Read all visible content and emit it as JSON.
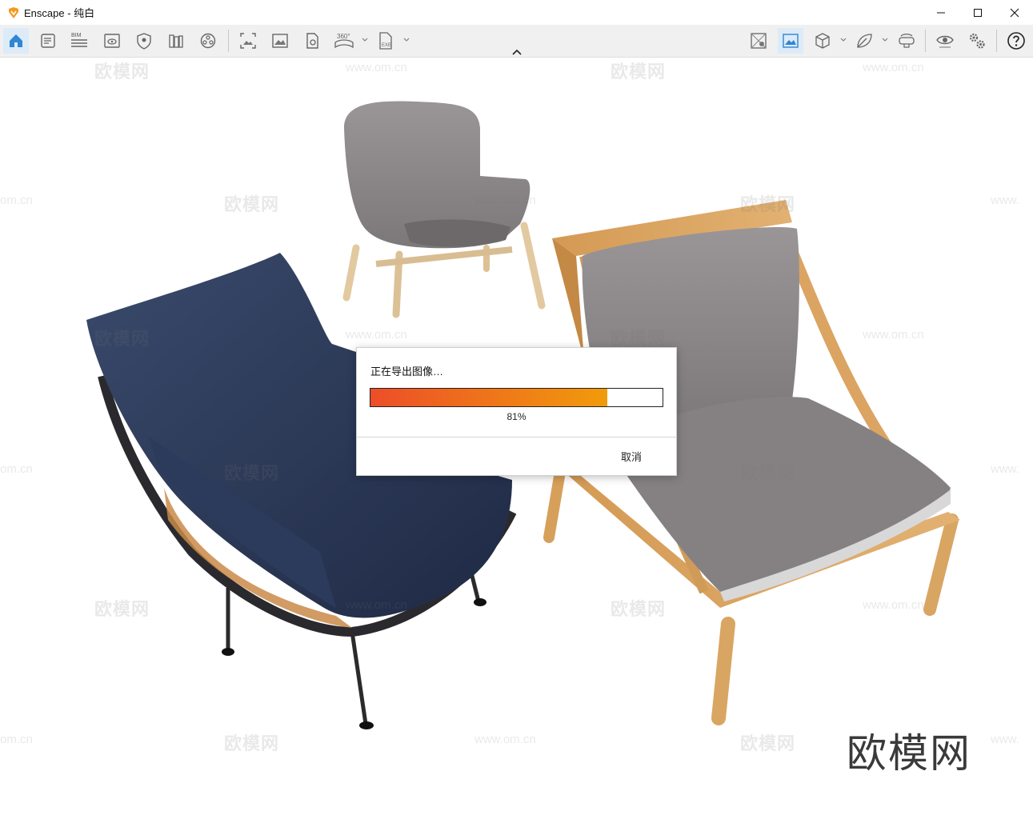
{
  "window": {
    "title": "Enscape - 纯白",
    "logo_icon": "enscape-logo-icon",
    "accent": "#f29b1d"
  },
  "toolbar": {
    "left": [
      {
        "icon": "home-icon",
        "active": true
      },
      {
        "icon": "document-settings-icon"
      },
      {
        "icon": "bim-icon",
        "label": "BIM"
      },
      {
        "icon": "view-eye-panel-icon"
      },
      {
        "icon": "shield-location-icon"
      },
      {
        "icon": "books-icon"
      },
      {
        "icon": "asset-library-icon"
      },
      {
        "icon": "screenshot-frame-icon"
      },
      {
        "icon": "image-export-icon"
      },
      {
        "icon": "batch-render-icon"
      },
      {
        "icon": "panorama-360-icon",
        "label": "360°"
      },
      {
        "icon": "exe-export-icon",
        "label": "EXE"
      }
    ],
    "right": [
      {
        "icon": "map-markers-icon"
      },
      {
        "icon": "image-frame-icon",
        "active": true
      },
      {
        "icon": "cube-icon"
      },
      {
        "icon": "leaf-icon"
      },
      {
        "icon": "vr-headset-icon"
      },
      {
        "icon": "eye-settings-icon"
      },
      {
        "icon": "gears-icon"
      },
      {
        "icon": "help-icon"
      }
    ]
  },
  "dialog": {
    "title": "正在导出图像…",
    "progress": 0.81,
    "percent_text": "81%",
    "cancel_label": "取消",
    "progress_colors": [
      "#ec4e28",
      "#f19b0b"
    ]
  },
  "watermark": {
    "brand": "欧模网",
    "url": "www.om.cn",
    "url_partial_left": "om.cn",
    "url_partial_right": "www."
  }
}
